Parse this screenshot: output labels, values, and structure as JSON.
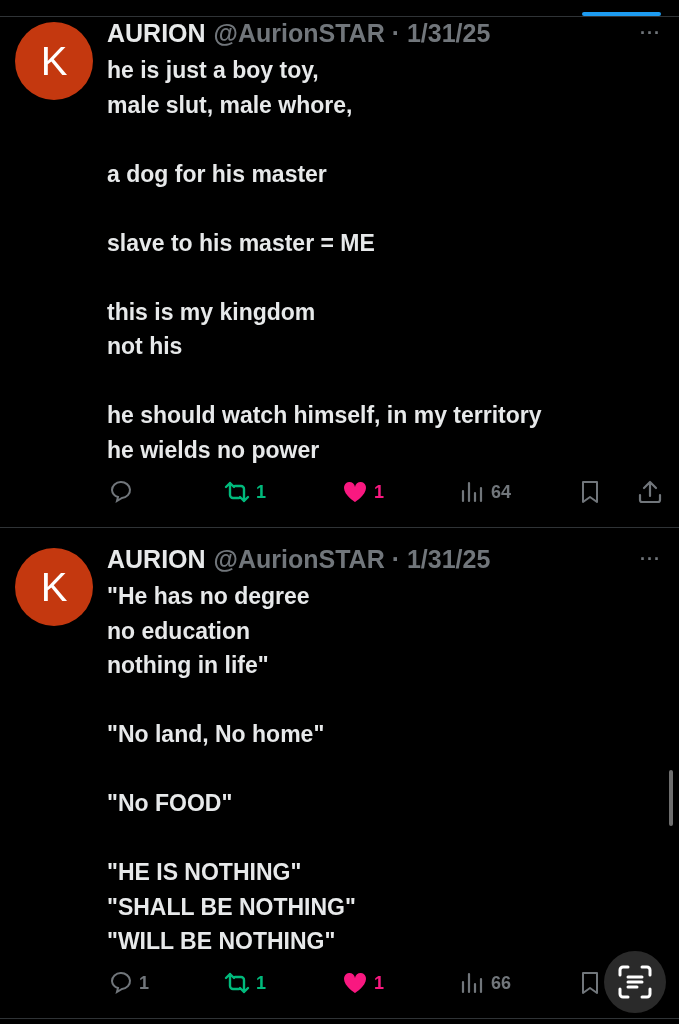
{
  "tweets": [
    {
      "avatar": "K",
      "name": "AURION",
      "handle": "@AurionSTAR",
      "separator": "·",
      "date": "1/31/25",
      "more": "···",
      "paragraphs": [
        [
          "he is just a boy toy,",
          "male slut, male whore,"
        ],
        [
          "a dog for his master"
        ],
        [
          "slave to his master = ME"
        ],
        [
          "this is my kingdom",
          "not his"
        ],
        [
          "he should watch himself, in my territory",
          "he wields no power"
        ]
      ],
      "actions": [
        {
          "kind": "reply",
          "active": false
        },
        {
          "kind": "retweet",
          "count": "1",
          "active": true
        },
        {
          "kind": "like",
          "count": "1",
          "active": true
        },
        {
          "kind": "views",
          "count": "64"
        },
        {
          "kind": "bookmark",
          "active": false
        },
        {
          "kind": "share"
        }
      ]
    },
    {
      "avatar": "K",
      "name": "AURION",
      "handle": "@AurionSTAR",
      "separator": "·",
      "date": "1/31/25",
      "more": "···",
      "paragraphs": [
        [
          "\"He has no degree",
          "no education",
          "nothing in life\""
        ],
        [
          "\"No land, No home\""
        ],
        [
          "\"No FOOD\""
        ],
        [
          "\"HE IS NOTHING\"",
          "\"SHALL BE NOTHING\"",
          "\"WILL BE NOTHING\""
        ]
      ],
      "actions": [
        {
          "kind": "reply",
          "count": "1",
          "active": false
        },
        {
          "kind": "retweet",
          "count": "1",
          "active": true
        },
        {
          "kind": "like",
          "count": "1",
          "active": true
        },
        {
          "kind": "views",
          "count": "66"
        },
        {
          "kind": "bookmark",
          "active": false
        }
      ]
    }
  ]
}
